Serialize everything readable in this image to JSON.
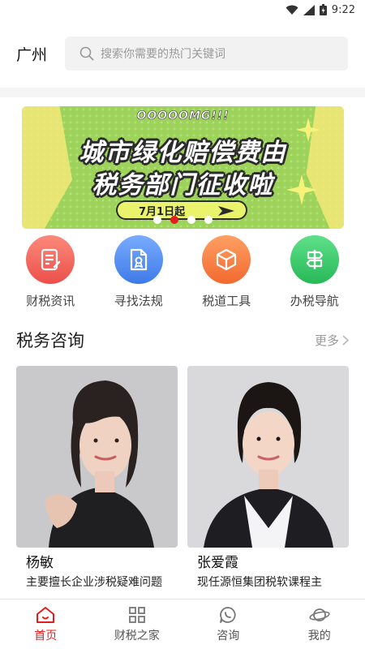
{
  "status_bar": {
    "time": "9:22"
  },
  "header": {
    "city": "广州",
    "search_placeholder": "搜索你需要的热门关键词"
  },
  "banner": {
    "kicker": "OOOOOMG!!!",
    "line1": "城市绿化赔偿费由",
    "line2": "税务部门征收啦",
    "date": "7月1日起",
    "slide_count": 4,
    "active_slide": 2
  },
  "shortcuts": [
    {
      "label": "财税资讯",
      "icon": "document-edit-icon",
      "color": "#f0645a"
    },
    {
      "label": "寻找法规",
      "icon": "certificate-file-icon",
      "color": "#4a86f0"
    },
    {
      "label": "税道工具",
      "icon": "box-icon",
      "color": "#f57a3d"
    },
    {
      "label": "办税导航",
      "icon": "signpost-icon",
      "color": "#3cc86a"
    }
  ],
  "consult": {
    "title": "税务咨询",
    "more": "更多",
    "advisors": [
      {
        "name": "杨敏",
        "desc": "主要擅长企业涉税疑难问题"
      },
      {
        "name": "张爱霞",
        "desc": "现任源恒集团税软课程主"
      }
    ]
  },
  "tabbar": {
    "active": "home",
    "tabs": [
      {
        "label": "首页",
        "icon": "home-icon"
      },
      {
        "label": "财税之家",
        "icon": "grid-icon"
      },
      {
        "label": "咨询",
        "icon": "phone-chat-icon"
      },
      {
        "label": "我的",
        "icon": "planet-icon"
      }
    ]
  },
  "colors": {
    "accent": "#e31e1e",
    "banner_green": "#9dd35a"
  }
}
